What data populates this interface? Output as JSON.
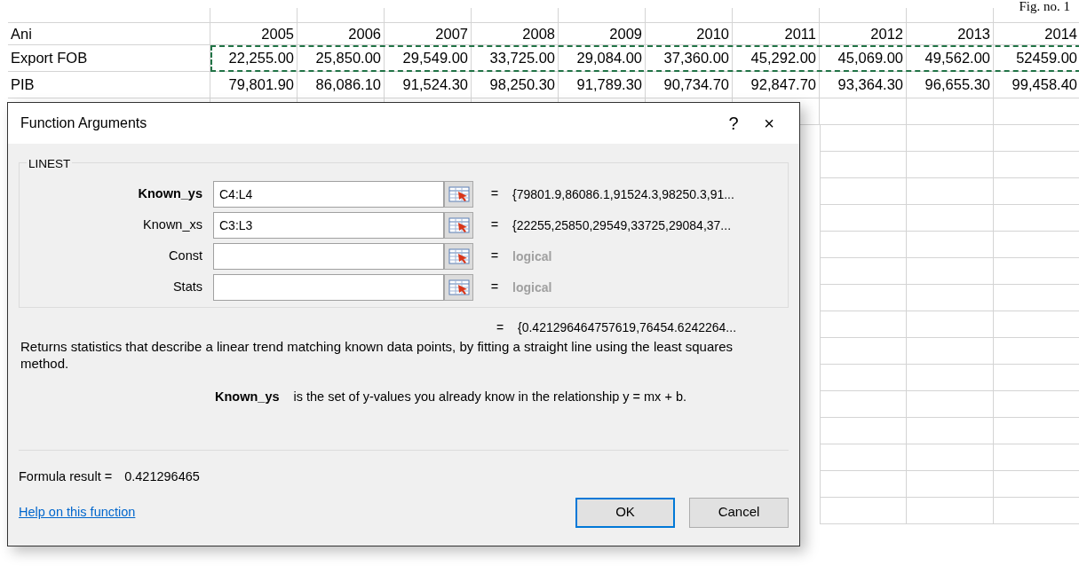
{
  "page_caption": "Fig. no. 1",
  "sheet": {
    "header_row": {
      "label": "Ani",
      "years": [
        "2005",
        "2006",
        "2007",
        "2008",
        "2009",
        "2010",
        "2011",
        "2012",
        "2013",
        "2014"
      ]
    },
    "rows": [
      {
        "label": "Export FOB",
        "values": [
          "22,255.00",
          "25,850.00",
          "29,549.00",
          "33,725.00",
          "29,084.00",
          "37,360.00",
          "45,292.00",
          "45,069.00",
          "49,562.00",
          "52459.00"
        ],
        "copy_marquee": true
      },
      {
        "label": "PIB",
        "values": [
          "79,801.90",
          "86,086.10",
          "91,524.30",
          "98,250.30",
          "91,789.30",
          "90,734.70",
          "92,847.70",
          "93,364.30",
          "96,655.30",
          "99,458.40"
        ],
        "copy_marquee": false
      }
    ]
  },
  "dialog": {
    "title": "Function Arguments",
    "help_button": "?",
    "close_button": "×",
    "function_name": "LINEST",
    "arguments": [
      {
        "name": "Known_ys",
        "value": "C4:L4",
        "result": "{79801.9,86086.1,91524.3,98250.3,91...",
        "focused": true,
        "result_greyed": false
      },
      {
        "name": "Known_xs",
        "value": "C3:L3",
        "result": "{22255,25850,29549,33725,29084,37...",
        "focused": false,
        "result_greyed": false
      },
      {
        "name": "Const",
        "result": "logical",
        "focused": false,
        "result_greyed": true
      },
      {
        "name": "Stats",
        "result": "logical",
        "focused": false,
        "result_greyed": true
      }
    ],
    "equals_sign": "=",
    "result_preview": "{0.421296464757619,76454.6242264...",
    "description": "Returns statistics that describe a linear trend matching known data points, by fitting a straight line using the least squares method.",
    "argument_help": {
      "name": "Known_ys",
      "text": "is the set of y-values you already know in the relationship y = mx + b."
    },
    "formula_result_label": "Formula result =",
    "formula_result": "0.421296465",
    "help_link": "Help on this function",
    "buttons": [
      {
        "label": "OK",
        "default": true
      },
      {
        "label": "Cancel",
        "default": false
      }
    ]
  }
}
